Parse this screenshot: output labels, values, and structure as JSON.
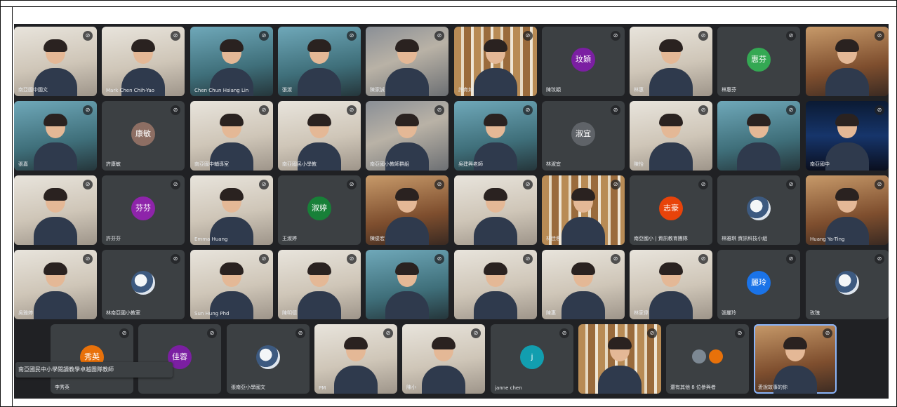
{
  "colors": {
    "meet_background": "#202124",
    "tile_background": "#3c4043",
    "self_highlight": "#8ab4f8",
    "name_text": "#e8eaed"
  },
  "tooltip": {
    "text": "南亞國民中小學閱讀教學卓越團隊教師"
  },
  "rows": [
    {
      "tiles": [
        {
          "kind": "video",
          "tone": "bright",
          "name": "南亞國中國文",
          "initials": "",
          "avatar_color": ""
        },
        {
          "kind": "video",
          "tone": "bright",
          "name": "Mark Chen Chih-Yao",
          "initials": "",
          "avatar_color": ""
        },
        {
          "kind": "video",
          "tone": "teal",
          "name": "Chen Chun Hsiang Lin",
          "initials": "",
          "avatar_color": ""
        },
        {
          "kind": "video",
          "tone": "teal",
          "name": "張淑",
          "initials": "",
          "avatar_color": ""
        },
        {
          "kind": "video",
          "tone": "",
          "name": "陳家誠",
          "initials": "",
          "avatar_color": ""
        },
        {
          "kind": "video",
          "tone": "shelf",
          "name": "許育如",
          "initials": "",
          "avatar_color": ""
        },
        {
          "kind": "avatar",
          "tone": "",
          "name": "陳玟穎",
          "initials": "玟穎",
          "avatar_color": "#7b1fa2"
        },
        {
          "kind": "video",
          "tone": "bright",
          "name": "林惠",
          "initials": "",
          "avatar_color": ""
        },
        {
          "kind": "avatar",
          "tone": "",
          "name": "林惠芬",
          "initials": "惠芬",
          "avatar_color": "#34a853"
        },
        {
          "kind": "video",
          "tone": "warm",
          "name": "",
          "initials": "",
          "avatar_color": ""
        }
      ]
    },
    {
      "tiles": [
        {
          "kind": "video",
          "tone": "teal",
          "name": "張嘉",
          "initials": "",
          "avatar_color": ""
        },
        {
          "kind": "avatar",
          "tone": "",
          "name": "許康敏",
          "initials": "康敏",
          "avatar_color": "#8d6e63"
        },
        {
          "kind": "video",
          "tone": "bright",
          "name": "南亞國中輔導室",
          "initials": "",
          "avatar_color": ""
        },
        {
          "kind": "video",
          "tone": "bright",
          "name": "南亞國民小學教",
          "initials": "",
          "avatar_color": ""
        },
        {
          "kind": "video",
          "tone": "",
          "name": "南亞國小教師群組",
          "initials": "",
          "avatar_color": ""
        },
        {
          "kind": "video",
          "tone": "teal",
          "name": "吳建興老師",
          "initials": "",
          "avatar_color": ""
        },
        {
          "kind": "avatar",
          "tone": "",
          "name": "林淑宜",
          "initials": "淑宜",
          "avatar_color": "#5f6368"
        },
        {
          "kind": "video",
          "tone": "bright",
          "name": "陳怡",
          "initials": "",
          "avatar_color": ""
        },
        {
          "kind": "video",
          "tone": "teal",
          "name": "",
          "initials": "",
          "avatar_color": ""
        },
        {
          "kind": "video",
          "tone": "space",
          "name": "南亞國中",
          "initials": "",
          "avatar_color": ""
        }
      ]
    },
    {
      "tiles": [
        {
          "kind": "video",
          "tone": "bright",
          "name": "",
          "initials": "",
          "avatar_color": ""
        },
        {
          "kind": "avatar",
          "tone": "",
          "name": "許芬芬",
          "initials": "芬芬",
          "avatar_color": "#8e24aa"
        },
        {
          "kind": "video",
          "tone": "bright",
          "name": "Emma Huang",
          "initials": "",
          "avatar_color": ""
        },
        {
          "kind": "avatar",
          "tone": "",
          "name": "王淑婷",
          "initials": "淑婷",
          "avatar_color": "#188038"
        },
        {
          "kind": "video",
          "tone": "warm",
          "name": "陳俊宏",
          "initials": "",
          "avatar_color": ""
        },
        {
          "kind": "video",
          "tone": "bright",
          "name": "",
          "initials": "",
          "avatar_color": ""
        },
        {
          "kind": "video",
          "tone": "shelf",
          "name": "林佳蓉",
          "initials": "",
          "avatar_color": ""
        },
        {
          "kind": "avatar",
          "tone": "",
          "name": "南亞國小 | 資訊教育團隊",
          "initials": "志豪",
          "avatar_color": "#e8430a"
        },
        {
          "kind": "avatar",
          "tone": "pic",
          "name": "林雅琪 資訊科技小組",
          "initials": "",
          "avatar_color": ""
        },
        {
          "kind": "video",
          "tone": "warm",
          "name": "Huang Ya-Ting",
          "initials": "",
          "avatar_color": ""
        }
      ]
    },
    {
      "tiles": [
        {
          "kind": "video",
          "tone": "bright",
          "name": "吳雅婷",
          "initials": "",
          "avatar_color": ""
        },
        {
          "kind": "avatar",
          "tone": "pic",
          "name": "林南亞國小教室",
          "initials": "",
          "avatar_color": ""
        },
        {
          "kind": "video",
          "tone": "bright",
          "name": "Sun Hung Phd",
          "initials": "",
          "avatar_color": ""
        },
        {
          "kind": "video",
          "tone": "bright",
          "name": "陳明德",
          "initials": "",
          "avatar_color": ""
        },
        {
          "kind": "video",
          "tone": "teal",
          "name": "",
          "initials": "",
          "avatar_color": ""
        },
        {
          "kind": "video",
          "tone": "bright",
          "name": "",
          "initials": "",
          "avatar_color": ""
        },
        {
          "kind": "video",
          "tone": "bright",
          "name": "陳惠",
          "initials": "",
          "avatar_color": ""
        },
        {
          "kind": "video",
          "tone": "bright",
          "name": "林家偉",
          "initials": "",
          "avatar_color": ""
        },
        {
          "kind": "avatar",
          "tone": "",
          "name": "張麗玲",
          "initials": "麗玲",
          "avatar_color": "#1a73e8"
        },
        {
          "kind": "avatar",
          "tone": "pic",
          "name": "玫瑰",
          "initials": "",
          "avatar_color": ""
        }
      ]
    },
    {
      "tiles": [
        {
          "kind": "avatar",
          "tone": "",
          "name": "李秀英",
          "initials": "秀英",
          "avatar_color": "#e8710a"
        },
        {
          "kind": "avatar",
          "tone": "",
          "name": "",
          "initials": "佳蓉",
          "avatar_color": "#7b1fa2"
        },
        {
          "kind": "avatar",
          "tone": "pic",
          "name": "張南亞小學國文",
          "initials": "",
          "avatar_color": ""
        },
        {
          "kind": "video",
          "tone": "bright",
          "name": "PM",
          "initials": "",
          "avatar_color": ""
        },
        {
          "kind": "video",
          "tone": "bright",
          "name": "陳小",
          "initials": "",
          "avatar_color": ""
        },
        {
          "kind": "avatar",
          "tone": "",
          "name": "janne chen",
          "initials": "j",
          "avatar_color": "#129eaf"
        },
        {
          "kind": "video",
          "tone": "shelf",
          "name": "",
          "initials": "",
          "avatar_color": ""
        },
        {
          "kind": "pair",
          "tone": "",
          "name": "還有其他 8 位參與者",
          "initials": "",
          "avatar_color": ""
        },
        {
          "kind": "video",
          "tone": "warm",
          "name": "愛說故事的你",
          "initials": "",
          "avatar_color": ""
        }
      ]
    }
  ]
}
